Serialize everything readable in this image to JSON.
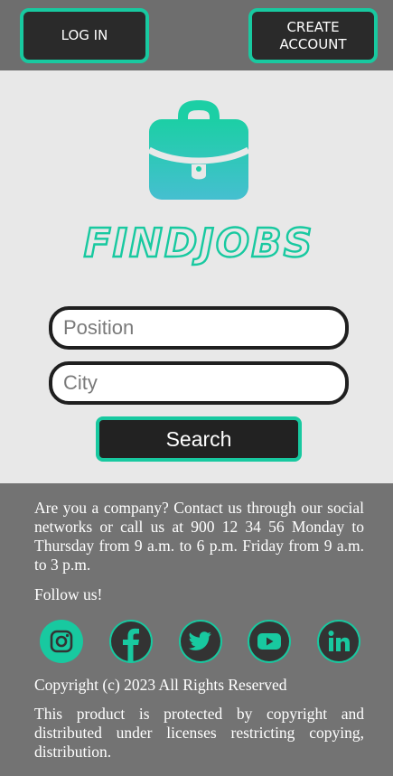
{
  "header": {
    "login_label": "LOG IN",
    "create_label": "CREATE\nACCOUNT"
  },
  "brand": {
    "name": "FINDJOBS",
    "icon": "briefcase-icon",
    "accent_color": "#18c9a0"
  },
  "search": {
    "position_placeholder": "Position",
    "position_value": "",
    "city_placeholder": "City",
    "city_value": "",
    "button_label": "Search"
  },
  "footer": {
    "contact_text": "Are you a company? Contact us through our social networks or call us at 900 12 34 56 Monday to Thursday from 9 a.m. to 6 p.m. Friday from 9 a.m. to 3 p.m.",
    "follow_label": "Follow us!",
    "social": [
      {
        "name": "instagram-icon"
      },
      {
        "name": "facebook-icon"
      },
      {
        "name": "twitter-icon"
      },
      {
        "name": "youtube-icon"
      },
      {
        "name": "linkedin-icon"
      }
    ],
    "copyright": "Copyright (c) 2023 All Rights Reserved",
    "legal": "This product is protected by copyright and distributed under licenses restricting copying, distribution."
  }
}
